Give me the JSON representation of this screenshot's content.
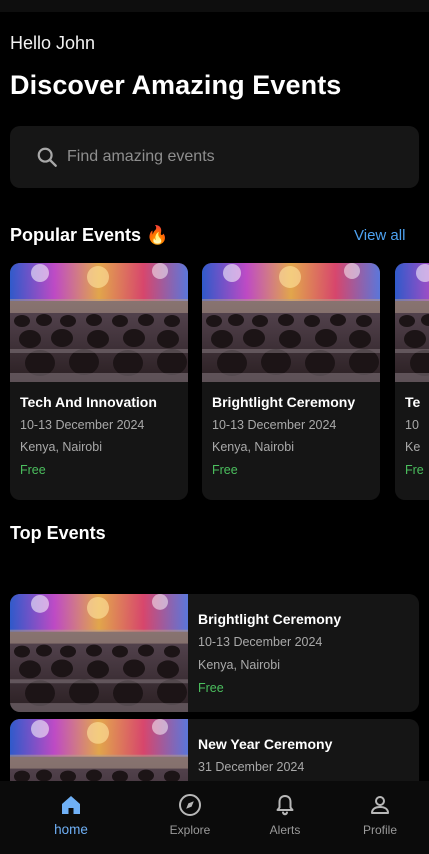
{
  "greeting": "Hello John",
  "headline": "Discover Amazing Events",
  "search": {
    "placeholder": "Find amazing events"
  },
  "popular": {
    "title": "Popular Events 🔥",
    "view_all": "View all",
    "events": [
      {
        "title": "Tech And Innovation",
        "date": "10-13 December 2024",
        "location": "Kenya, Nairobi",
        "price": "Free"
      },
      {
        "title": "Brightlight Ceremony",
        "date": "10-13 December 2024",
        "location": "Kenya, Nairobi",
        "price": "Free"
      },
      {
        "title": "Te",
        "date": "10",
        "location": "Ke",
        "price": "Fre"
      }
    ]
  },
  "top": {
    "title": "Top Events",
    "events": [
      {
        "title": "Brightlight Ceremony",
        "date": "10-13 December 2024",
        "location": "Kenya, Nairobi",
        "price": "Free"
      },
      {
        "title": "New Year Ceremony",
        "date": "31 December 2024"
      }
    ]
  },
  "nav": {
    "items": [
      {
        "label": "home",
        "icon": "home-icon",
        "active": true
      },
      {
        "label": "Explore",
        "icon": "compass-icon",
        "active": false
      },
      {
        "label": "Alerts",
        "icon": "bell-icon",
        "active": false
      },
      {
        "label": "Profile",
        "icon": "person-icon",
        "active": false
      }
    ]
  },
  "colors": {
    "background": "#000000",
    "surface": "#151515",
    "accent": "#4ea3f2",
    "price": "#4bbf5e",
    "muted_text": "#a9a9a9"
  }
}
